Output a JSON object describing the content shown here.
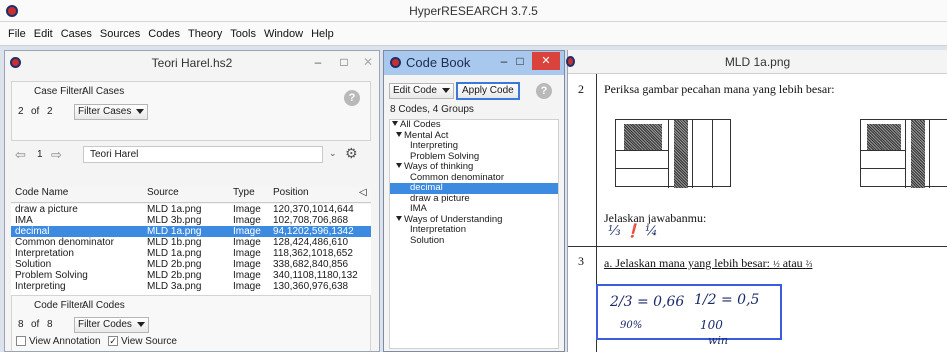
{
  "app": {
    "title": "HyperRESEARCH 3.7.5",
    "menu": [
      "File",
      "Edit",
      "Cases",
      "Sources",
      "Codes",
      "Theory",
      "Tools",
      "Window",
      "Help"
    ]
  },
  "harel_window": {
    "title": "Teori Harel.hs2",
    "case_filter_label": "Case Filter:",
    "case_filter_value": "All Cases",
    "case_index": "2",
    "case_of": "of",
    "case_total": "2",
    "filter_cases_button": "Filter Cases",
    "nav_current": "1",
    "nav_case_name": "Teori Harel",
    "columns": [
      "Code Name",
      "Source",
      "Type",
      "Position"
    ],
    "rows": [
      {
        "name": "draw a picture",
        "source": "MLD 1a.png",
        "type": "Image",
        "position": "120,370,1014,644",
        "selected": false
      },
      {
        "name": "IMA",
        "source": "MLD 3b.png",
        "type": "Image",
        "position": "102,708,706,868",
        "selected": false
      },
      {
        "name": "decimal",
        "source": "MLD 1a.png",
        "type": "Image",
        "position": "94,1202,596,1342",
        "selected": true
      },
      {
        "name": "Common denominator",
        "source": "MLD 1b.png",
        "type": "Image",
        "position": "128,424,486,610",
        "selected": false
      },
      {
        "name": "Interpretation",
        "source": "MLD 1a.png",
        "type": "Image",
        "position": "118,362,1018,652",
        "selected": false
      },
      {
        "name": "Solution",
        "source": "MLD 2b.png",
        "type": "Image",
        "position": "338,682,840,856",
        "selected": false
      },
      {
        "name": "Problem Solving",
        "source": "MLD 2b.png",
        "type": "Image",
        "position": "340,1108,1180,132",
        "selected": false
      },
      {
        "name": "Interpreting",
        "source": "MLD 3a.png",
        "type": "Image",
        "position": "130,360,976,638",
        "selected": false
      }
    ],
    "code_filter_label": "Code Filter:",
    "code_filter_value": "All Codes",
    "code_index": "8",
    "code_of": "of",
    "code_total": "8",
    "filter_codes_button": "Filter Codes",
    "view_annotation_label": "View Annotation",
    "view_annotation_checked": false,
    "view_source_label": "View Source",
    "view_source_checked": true
  },
  "codebook": {
    "title": "Code Book",
    "edit_code_button": "Edit Code",
    "apply_code_button": "Apply Code",
    "summary": "8 Codes, 4 Groups",
    "tree": [
      {
        "label": "All Codes",
        "level": 0,
        "group": true,
        "selected": false
      },
      {
        "label": "Mental Act",
        "level": 1,
        "group": true,
        "selected": false
      },
      {
        "label": "Interpreting",
        "level": 2,
        "group": false,
        "selected": false
      },
      {
        "label": "Problem Solving",
        "level": 2,
        "group": false,
        "selected": false
      },
      {
        "label": "Ways of thinking",
        "level": 1,
        "group": true,
        "selected": false
      },
      {
        "label": "Common denominator",
        "level": 2,
        "group": false,
        "selected": false
      },
      {
        "label": "decimal",
        "level": 2,
        "group": false,
        "selected": true
      },
      {
        "label": "draw a picture",
        "level": 2,
        "group": false,
        "selected": false
      },
      {
        "label": "IMA",
        "level": 2,
        "group": false,
        "selected": false
      },
      {
        "label": "Ways of Understanding",
        "level": 1,
        "group": true,
        "selected": false
      },
      {
        "label": "Interpretation",
        "level": 2,
        "group": false,
        "selected": false
      },
      {
        "label": "Solution",
        "level": 2,
        "group": false,
        "selected": false
      }
    ]
  },
  "mld_window": {
    "title": "MLD 1a.png",
    "q2_number": "2",
    "q2_text": "Periksa gambar pecahan mana yang lebih besar:",
    "q2_explain": "Jelaskan jawabanmu:",
    "q3_number": "3",
    "q3_text": "a.  Jelaskan mana yang lebih besar:",
    "q3_or": "atau",
    "hand_answer_left": "2/3 = 0,66",
    "hand_answer_right": "1/2 = 0,5",
    "hand_pct_left": "90%",
    "hand_pct_right": "100",
    "hand_bottom": "win"
  },
  "colors": {
    "selection": "#3d8be0",
    "codebook_titlebar": "#a9c8ee",
    "close_button": "#d9433c",
    "annotation_box": "#3c5de0",
    "logo_red": "#c8302e"
  }
}
